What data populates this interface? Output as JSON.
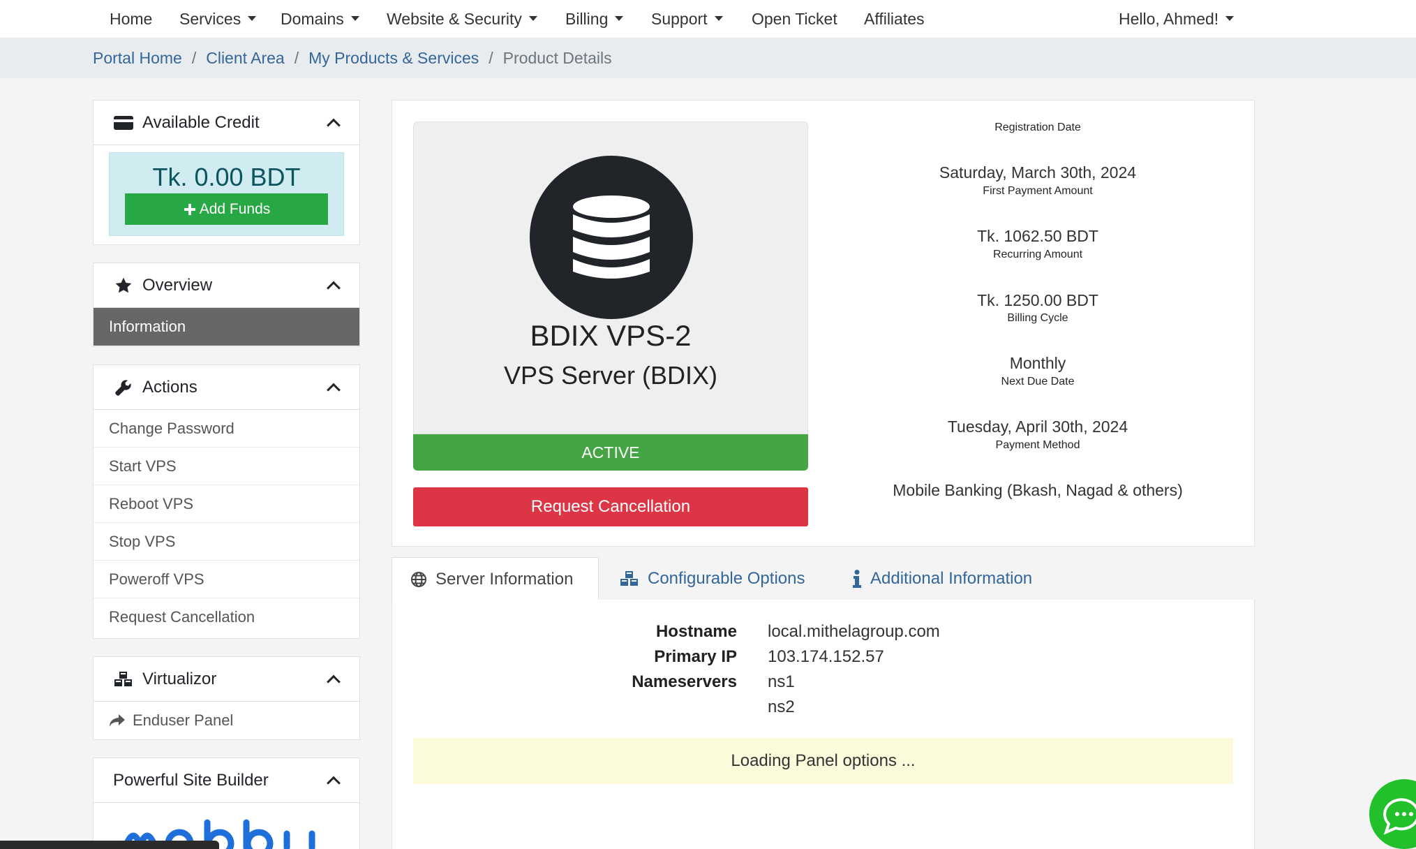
{
  "nav": {
    "home": "Home",
    "services": "Services",
    "domains": "Domains",
    "website_security": "Website & Security",
    "billing": "Billing",
    "support": "Support",
    "open_ticket": "Open Ticket",
    "affiliates": "Affiliates",
    "user_greeting": "Hello, Ahmed!"
  },
  "breadcrumb": {
    "items": [
      "Portal Home",
      "Client Area",
      "My Products & Services"
    ],
    "current": "Product Details"
  },
  "sidebar": {
    "credit": {
      "title": "Available Credit",
      "amount": "Tk. 0.00 BDT",
      "add_funds": "Add Funds"
    },
    "overview": {
      "title": "Overview",
      "items": [
        "Information"
      ]
    },
    "actions": {
      "title": "Actions",
      "items": [
        "Change Password",
        "Start VPS",
        "Reboot VPS",
        "Stop VPS",
        "Poweroff VPS",
        "Request Cancellation"
      ]
    },
    "virtualizor": {
      "title": "Virtualizor",
      "items": [
        "Enduser Panel"
      ]
    },
    "site_builder": {
      "title": "Powerful Site Builder"
    }
  },
  "product": {
    "name": "BDIX VPS-2",
    "group": "VPS Server (BDIX)",
    "status": "ACTIVE",
    "cancel_label": "Request Cancellation"
  },
  "details": {
    "registration_date_label": "Registration Date",
    "registration_date": "Saturday, March 30th, 2024",
    "first_payment_label": "First Payment Amount",
    "first_payment": "Tk. 1062.50 BDT",
    "recurring_label": "Recurring Amount",
    "recurring": "Tk. 1250.00 BDT",
    "billing_cycle_label": "Billing Cycle",
    "billing_cycle": "Monthly",
    "next_due_label": "Next Due Date",
    "next_due": "Tuesday, April 30th, 2024",
    "payment_method_label": "Payment Method",
    "payment_method": "Mobile Banking (Bkash, Nagad & others)"
  },
  "tabs": {
    "server_info": "Server Information",
    "configurable": "Configurable Options",
    "additional": "Additional Information"
  },
  "server_info": {
    "hostname_label": "Hostname",
    "hostname": "local.mithelagroup.com",
    "primary_ip_label": "Primary IP",
    "primary_ip": "103.174.152.57",
    "nameservers_label": "Nameservers",
    "ns1": "ns1",
    "ns2": "ns2",
    "loading": "Loading Panel options ..."
  },
  "colors": {
    "link": "#336699",
    "success": "#28a745",
    "danger": "#dc3545",
    "chat": "#22c02a"
  },
  "icons": [
    "credit-card-icon",
    "star-icon",
    "wrench-icon",
    "cubes-icon",
    "share-icon",
    "database-icon",
    "globe-icon",
    "info-icon",
    "chat-icon",
    "plus-icon",
    "chevron-up-icon"
  ]
}
